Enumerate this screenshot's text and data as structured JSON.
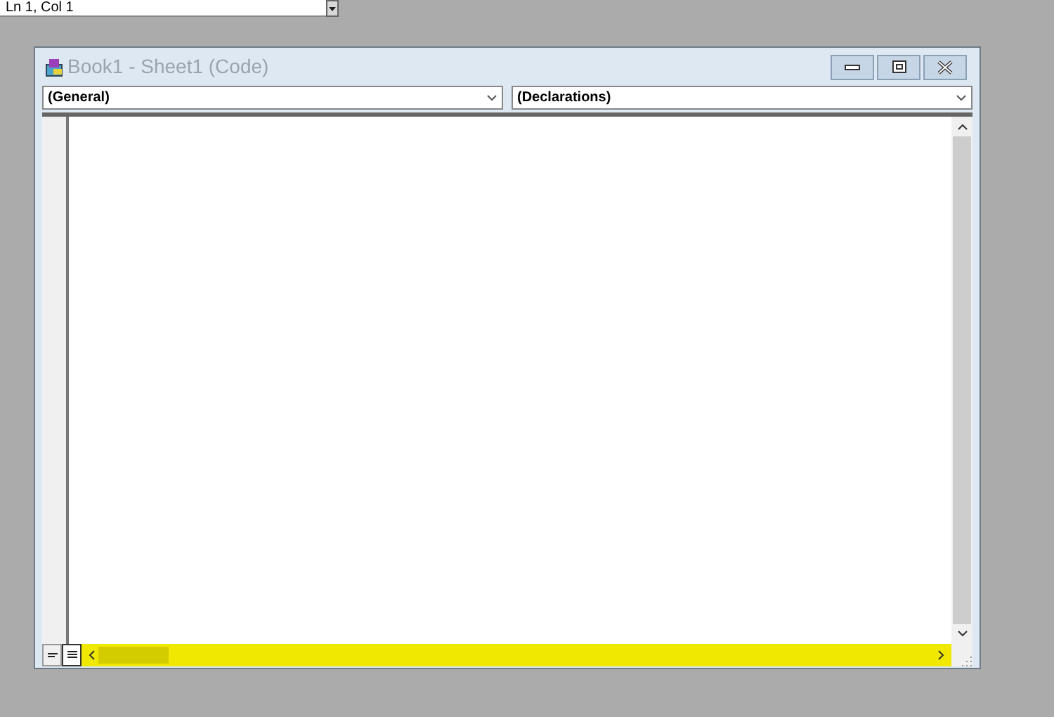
{
  "status_field": {
    "value": "Ln 1, Col 1"
  },
  "window": {
    "title": "Book1 - Sheet1 (Code)"
  },
  "object_dropdown": {
    "value": "(General)"
  },
  "procedure_dropdown": {
    "value": "(Declarations)"
  }
}
